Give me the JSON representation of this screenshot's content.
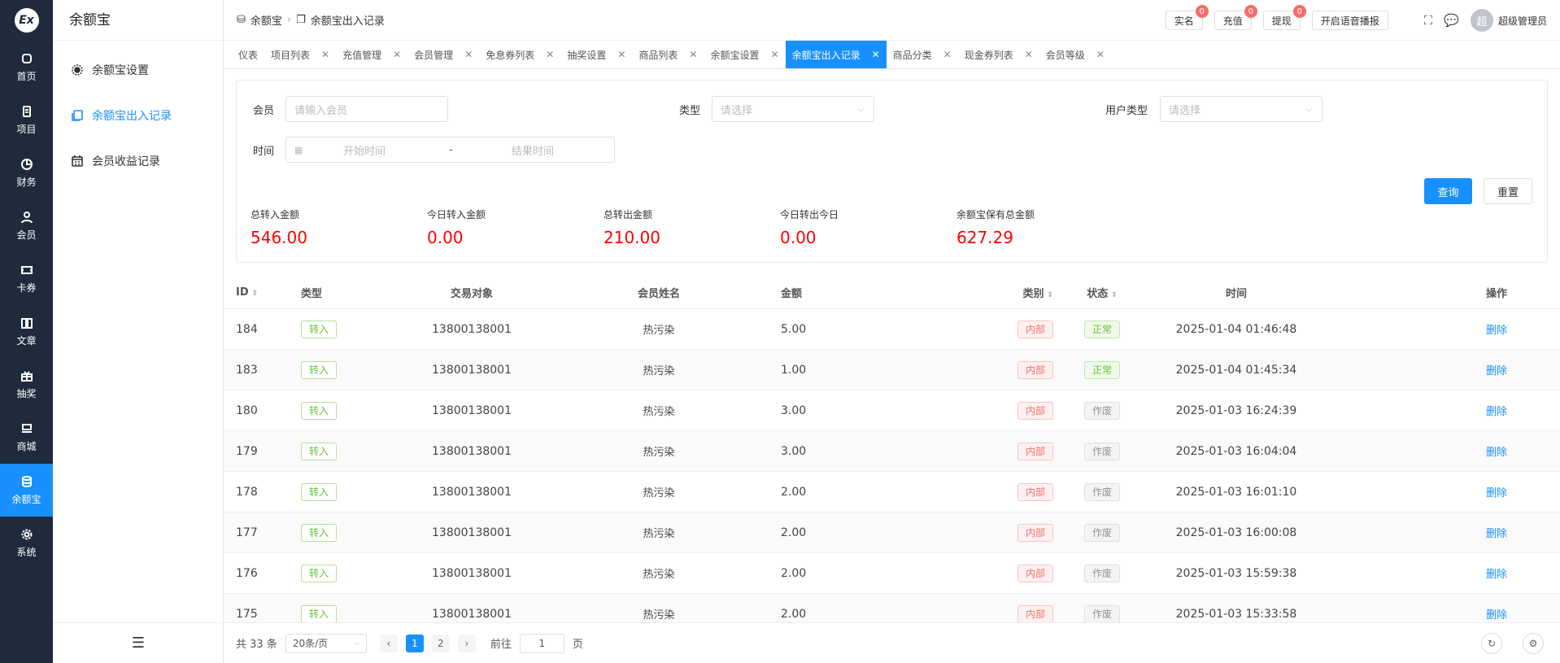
{
  "rail": {
    "items": [
      {
        "label": "首页",
        "icon": "dashboard-icon"
      },
      {
        "label": "项目",
        "icon": "project-icon"
      },
      {
        "label": "财务",
        "icon": "finance-icon"
      },
      {
        "label": "会员",
        "icon": "member-icon"
      },
      {
        "label": "卡券",
        "icon": "ticket-icon"
      },
      {
        "label": "文章",
        "icon": "article-icon"
      },
      {
        "label": "抽奖",
        "icon": "gift-icon"
      },
      {
        "label": "商城",
        "icon": "shop-icon"
      },
      {
        "label": "余额宝",
        "icon": "database-icon"
      },
      {
        "label": "系统",
        "icon": "gear-icon"
      }
    ]
  },
  "sidebar": {
    "title": "余额宝",
    "items": [
      {
        "label": "余额宝设置"
      },
      {
        "label": "余额宝出入记录"
      },
      {
        "label": "会员收益记录"
      }
    ]
  },
  "header": {
    "crumb1": "余额宝",
    "crumb2": "余额宝出入记录",
    "btn_realname": "实名",
    "btn_recharge": "充值",
    "btn_withdraw": "提现",
    "badge_realname": "0",
    "badge_recharge": "0",
    "badge_withdraw": "0",
    "btn_voice": "开启语音播报",
    "avatar_char": "超",
    "user_name": "超级管理员"
  },
  "tabs": [
    "仪表",
    "项目列表",
    "充值管理",
    "会员管理",
    "免息券列表",
    "抽奖设置",
    "商品列表",
    "余额宝设置",
    "余额宝出入记录",
    "商品分类",
    "现金券列表",
    "会员等级"
  ],
  "filter": {
    "member_label": "会员",
    "member_placeholder": "请输入会员",
    "type_label": "类型",
    "type_placeholder": "请选择",
    "usertype_label": "用户类型",
    "usertype_placeholder": "请选择",
    "time_label": "时间",
    "start_placeholder": "开始时间",
    "range_sep": "-",
    "end_placeholder": "结果时间",
    "query_label": "查询",
    "reset_label": "重置"
  },
  "stats": [
    {
      "label": "总转入金额",
      "value": "546.00"
    },
    {
      "label": "今日转入金额",
      "value": "0.00"
    },
    {
      "label": "总转出金额",
      "value": "210.00"
    },
    {
      "label": "今日转出今日",
      "value": "0.00"
    },
    {
      "label": "余额宝保有总金额",
      "value": "627.29"
    }
  ],
  "table": {
    "headers": {
      "id": "ID",
      "type": "类型",
      "target": "交易对象",
      "name": "会员姓名",
      "amount": "金额",
      "category": "类别",
      "status": "状态",
      "time": "时间",
      "action": "操作"
    },
    "rows": [
      {
        "id": "184",
        "type": "转入",
        "target": "13800138001",
        "name": "热污染",
        "amount": "5.00",
        "category": "内部",
        "status": "正常",
        "time": "2025-01-04 01:46:48",
        "action": "删除"
      },
      {
        "id": "183",
        "type": "转入",
        "target": "13800138001",
        "name": "热污染",
        "amount": "1.00",
        "category": "内部",
        "status": "正常",
        "time": "2025-01-04 01:45:34",
        "action": "删除"
      },
      {
        "id": "180",
        "type": "转入",
        "target": "13800138001",
        "name": "热污染",
        "amount": "3.00",
        "category": "内部",
        "status": "作废",
        "time": "2025-01-03 16:24:39",
        "action": "删除"
      },
      {
        "id": "179",
        "type": "转入",
        "target": "13800138001",
        "name": "热污染",
        "amount": "3.00",
        "category": "内部",
        "status": "作废",
        "time": "2025-01-03 16:04:04",
        "action": "删除"
      },
      {
        "id": "178",
        "type": "转入",
        "target": "13800138001",
        "name": "热污染",
        "amount": "2.00",
        "category": "内部",
        "status": "作废",
        "time": "2025-01-03 16:01:10",
        "action": "删除"
      },
      {
        "id": "177",
        "type": "转入",
        "target": "13800138001",
        "name": "热污染",
        "amount": "2.00",
        "category": "内部",
        "status": "作废",
        "time": "2025-01-03 16:00:08",
        "action": "删除"
      },
      {
        "id": "176",
        "type": "转入",
        "target": "13800138001",
        "name": "热污染",
        "amount": "2.00",
        "category": "内部",
        "status": "作废",
        "time": "2025-01-03 15:59:38",
        "action": "删除"
      },
      {
        "id": "175",
        "type": "转入",
        "target": "13800138001",
        "name": "热污染",
        "amount": "2.00",
        "category": "内部",
        "status": "作废",
        "time": "2025-01-03 15:33:58",
        "action": "删除"
      }
    ]
  },
  "pager": {
    "total": "共 33 条",
    "page_size": "20条/页",
    "pages": [
      "1",
      "2"
    ],
    "goto_label": "前往",
    "goto_value": "1",
    "page_unit": "页"
  },
  "colors": {
    "primary": "#1890ff",
    "rail_bg": "#1f2a3d",
    "stat_red": "#ff0000"
  }
}
